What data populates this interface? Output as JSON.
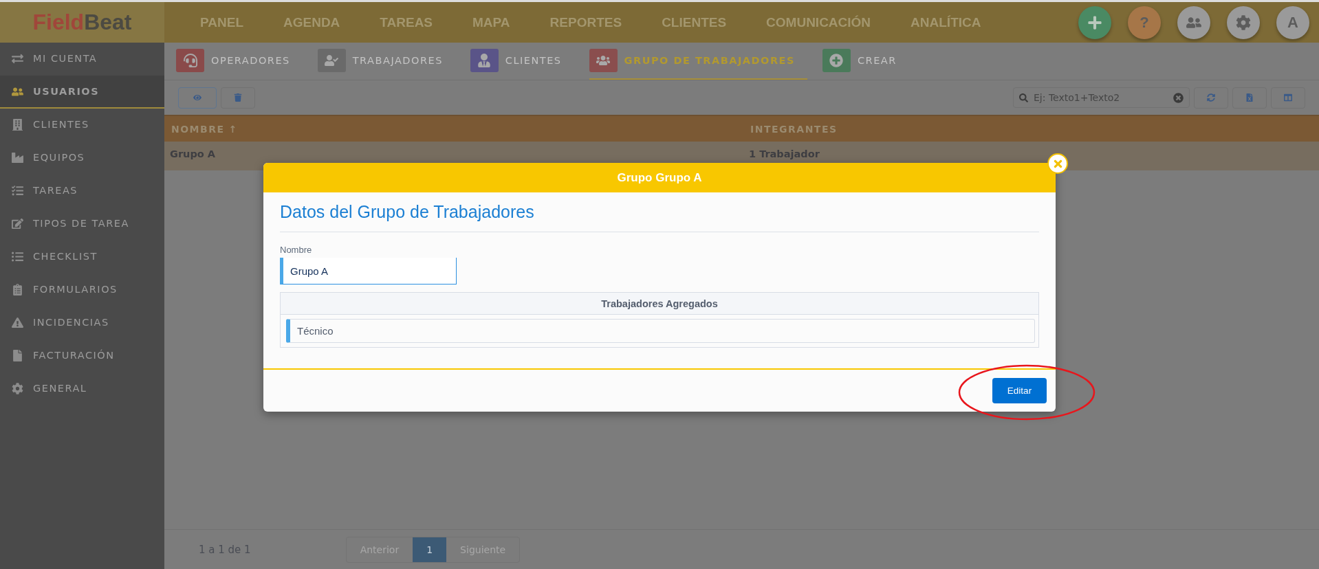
{
  "logo": {
    "part1": "Field",
    "part2": "Beat"
  },
  "top_nav": [
    "PANEL",
    "AGENDA",
    "TAREAS",
    "MAPA",
    "REPORTES",
    "CLIENTES",
    "COMUNICACIÓN",
    "ANALÍTICA"
  ],
  "top_actions": [
    {
      "kind": "add"
    },
    {
      "kind": "help",
      "label": "?"
    },
    {
      "kind": "users"
    },
    {
      "kind": "settings"
    },
    {
      "kind": "avatar",
      "label": "A"
    }
  ],
  "sidebar": {
    "items": [
      {
        "label": "MI CUENTA",
        "selected": false
      },
      {
        "label": "USUARIOS",
        "selected": true
      },
      {
        "label": "CLIENTES",
        "selected": false
      },
      {
        "label": "EQUIPOS",
        "selected": false
      },
      {
        "label": "TAREAS",
        "selected": false
      },
      {
        "label": "TIPOS DE TAREA",
        "selected": false
      },
      {
        "label": "CHECKLIST",
        "selected": false
      },
      {
        "label": "FORMULARIOS",
        "selected": false
      },
      {
        "label": "INCIDENCIAS",
        "selected": false
      },
      {
        "label": "FACTURACIÓN",
        "selected": false
      },
      {
        "label": "GENERAL",
        "selected": false
      }
    ]
  },
  "tabs": [
    {
      "label": "OPERADORES",
      "color": "#8a4a4a",
      "selected": false
    },
    {
      "label": "TRABAJADORES",
      "color": "#6a6a6a",
      "selected": false
    },
    {
      "label": "CLIENTES",
      "color": "#5a5488",
      "selected": false
    },
    {
      "label": "GRUPO DE TRABAJADORES",
      "color": "#8a4e4e",
      "selected": true
    },
    {
      "label": "CREAR",
      "color": "#4a7a5a",
      "selected": false
    }
  ],
  "toolbar": {
    "search": {
      "placeholder": "Ej: Texto1+Texto2"
    }
  },
  "table": {
    "columns": [
      {
        "label": "NOMBRE",
        "sort": "↑"
      },
      {
        "label": "INTEGRANTES"
      }
    ],
    "rows": [
      {
        "cells": [
          "Grupo A",
          "1 Trabajador"
        ],
        "selected": true
      }
    ]
  },
  "pagination": {
    "summary": "1 a 1 de 1",
    "prev": "Anterior",
    "pages": [
      {
        "label": "1",
        "selected": true
      }
    ],
    "next": "Siguiente"
  },
  "dialog": {
    "title": "Grupo Grupo A",
    "section_title": "Datos del Grupo de Trabajadores",
    "name_label": "Nombre",
    "name_value": "Grupo A",
    "list_title": "Trabajadores Agregados",
    "list_items": [
      "Técnico"
    ],
    "button": "Editar"
  }
}
